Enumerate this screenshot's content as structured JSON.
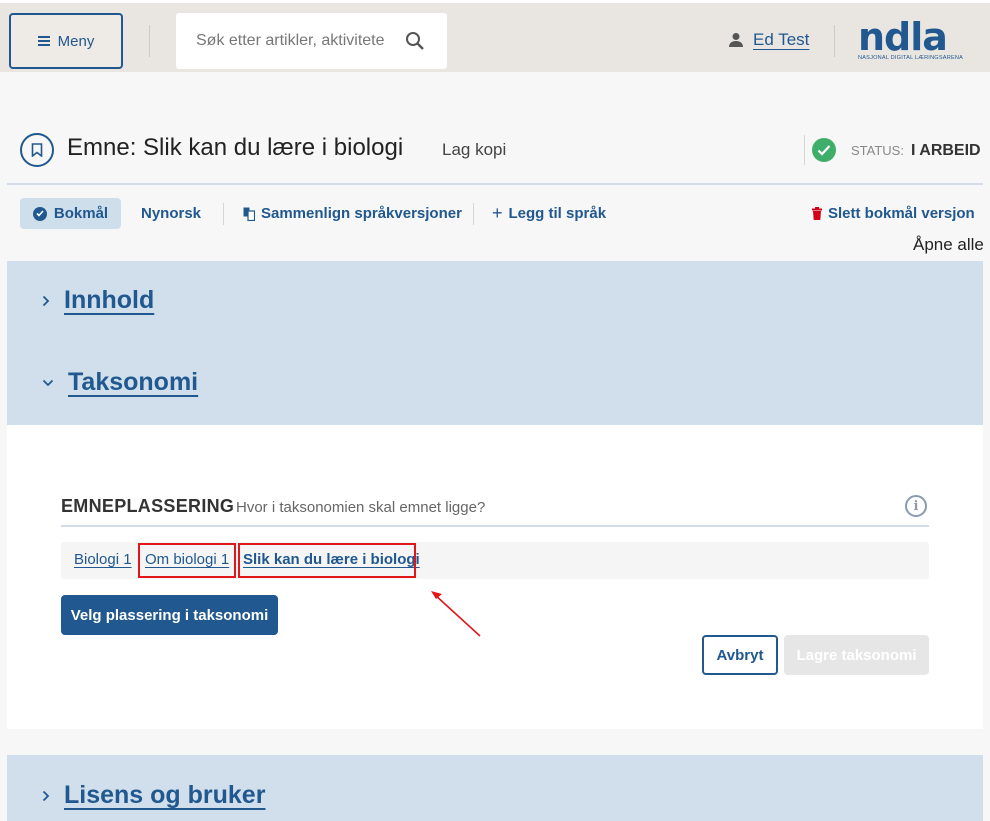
{
  "header": {
    "menu_label": "Meny",
    "search_placeholder": "Søk etter artikler, aktiviteter",
    "user_name": "Ed Test",
    "logo_text": "ndla",
    "logo_subtitle": "NASJONAL DIGITAL LÆRINGSARENA"
  },
  "page": {
    "title": "Emne: Slik kan du lære i biologi",
    "copy_label": "Lag kopi",
    "status_label": "STATUS:",
    "status_value": "I ARBEID"
  },
  "languages": {
    "active": "Bokmål",
    "other": "Nynorsk",
    "compare": "Sammenlign språkversjoner",
    "add": "Legg til språk",
    "delete": "Slett bokmål versjon"
  },
  "open_all": "Åpne alle",
  "sections": {
    "content": "Innhold",
    "taxonomy": "Taksonomi",
    "license": "Lisens og bruker"
  },
  "taxonomy": {
    "heading": "EMNEPLASSERING",
    "subheading": "Hvor i taksonomien skal emnet ligge?",
    "breadcrumb": [
      "Biologi 1",
      "Om biologi 1",
      "Slik kan du lære i biologi"
    ],
    "choose_button": "Velg plassering i taksonomi",
    "cancel_button": "Avbryt",
    "save_button": "Lagre taksonomi"
  },
  "colors": {
    "brand": "#20588f",
    "panel": "#d0dfeb",
    "status_ok": "#3fae6a",
    "annotation": "#e0161b"
  }
}
